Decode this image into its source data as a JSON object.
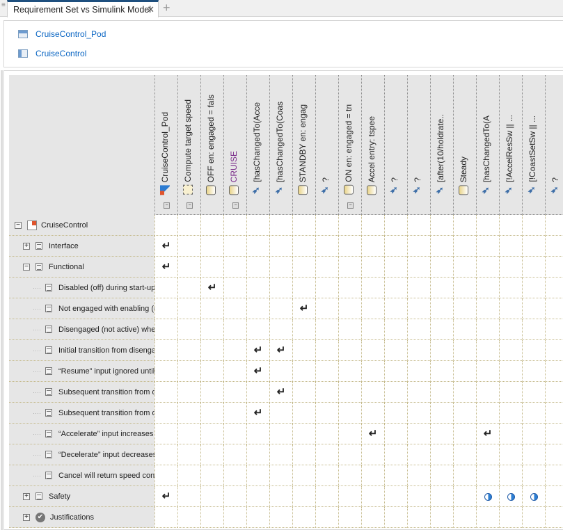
{
  "tab": {
    "title": "Requirement Set vs Simulink Model",
    "close": "✕",
    "add": "+"
  },
  "models": [
    {
      "name": "CruiseControl_Pod",
      "icon": "model-reference-icon"
    },
    {
      "name": "CruiseControl",
      "icon": "model-icon"
    }
  ],
  "columns": [
    {
      "label": "CruiseControl_Pod",
      "icon": "model",
      "expand": true
    },
    {
      "label": "Compute target speed",
      "icon": "function",
      "expand": true
    },
    {
      "label": "OFF  en: engaged = fals",
      "icon": "state"
    },
    {
      "label": "CRUISE",
      "icon": "state",
      "expand": true
    },
    {
      "label": "[hasChangedTo(Acce",
      "icon": "transition"
    },
    {
      "label": "[hasChangedTo(Coas",
      "icon": "transition"
    },
    {
      "label": "STANDBY  en: engag",
      "icon": "state"
    },
    {
      "label": "?",
      "icon": "transition"
    },
    {
      "label": "ON  en: engaged = trι",
      "icon": "state",
      "expand": true
    },
    {
      "label": "Accel  entry: tspee",
      "icon": "state"
    },
    {
      "label": "?",
      "icon": "transition"
    },
    {
      "label": "?",
      "icon": "transition"
    },
    {
      "label": "[after(10/holdrate..",
      "icon": "transition"
    },
    {
      "label": "Steady",
      "icon": "state"
    },
    {
      "label": "[hasChangedTo(A",
      "icon": "transition"
    },
    {
      "label": "[!AccelResSw || ...",
      "icon": "transition"
    },
    {
      "label": "[!CoastSetSw || ...",
      "icon": "transition"
    },
    {
      "label": "?",
      "icon": "transition"
    }
  ],
  "rows": [
    {
      "label": "CruiseControl",
      "level": 0,
      "toggle": "−",
      "icon": "model",
      "marks": {}
    },
    {
      "label": "Interface",
      "level": 1,
      "toggle": "+",
      "icon": "doc",
      "marks": {
        "0": "link"
      }
    },
    {
      "label": "Functional",
      "level": 1,
      "toggle": "−",
      "icon": "doc",
      "marks": {
        "0": "link"
      }
    },
    {
      "label": "Disabled (off) during start-up",
      "level": 2,
      "icon": "doc",
      "marks": {
        "2": "link"
      }
    },
    {
      "label": "Not engaged with enabling (o",
      "level": 2,
      "icon": "doc",
      "marks": {
        "6": "link"
      }
    },
    {
      "label": "Disengaged (not active) whe",
      "level": 2,
      "icon": "doc",
      "marks": {}
    },
    {
      "label": "Initial transition from disenga",
      "level": 2,
      "icon": "doc",
      "marks": {
        "4": "link",
        "5": "link"
      }
    },
    {
      "label": "“Resume” input ignored until",
      "level": 2,
      "icon": "doc",
      "marks": {
        "4": "link"
      }
    },
    {
      "label": "Subsequent transition from d",
      "level": 2,
      "icon": "doc",
      "marks": {
        "5": "link"
      }
    },
    {
      "label": "Subsequent transition from d",
      "level": 2,
      "icon": "doc",
      "marks": {
        "4": "link"
      }
    },
    {
      "label": "“Accelerate” input increases",
      "level": 2,
      "icon": "doc",
      "marks": {
        "9": "link",
        "14": "link"
      }
    },
    {
      "label": "“Decelerate” input decreases",
      "level": 2,
      "icon": "doc",
      "marks": {}
    },
    {
      "label": "Cancel will return speed cont",
      "level": 2,
      "icon": "doc",
      "marks": {}
    },
    {
      "label": "Safety",
      "level": 1,
      "toggle": "+",
      "icon": "doc",
      "marks": {
        "0": "link",
        "14": "partial",
        "15": "partial",
        "16": "partial"
      }
    },
    {
      "label": "Justifications",
      "level": 1,
      "toggle": "+",
      "icon": "justification",
      "marks": {}
    }
  ],
  "glyphs": {
    "link": "↵",
    "toggle_minus": "−"
  }
}
